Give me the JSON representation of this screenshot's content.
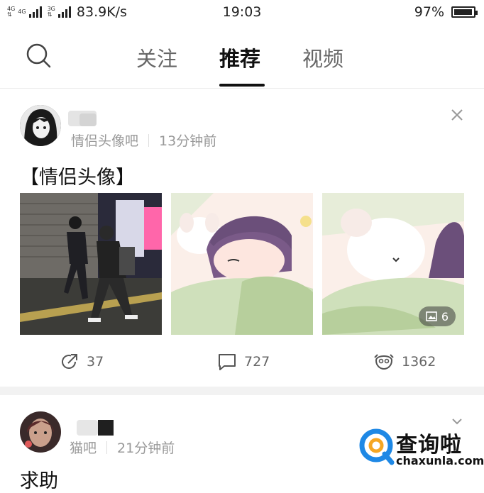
{
  "status_bar": {
    "network_labels": [
      "4G",
      "4G",
      "3G"
    ],
    "speed": "83.9K/s",
    "time": "19:03",
    "battery": "97%",
    "battery_level": 0.97
  },
  "nav": {
    "tabs": [
      {
        "label": "关注",
        "active": false
      },
      {
        "label": "推荐",
        "active": true
      },
      {
        "label": "视频",
        "active": false
      }
    ]
  },
  "posts": [
    {
      "source": "情侣头像吧",
      "time_ago": "13分钟前",
      "title": "【情侣头像】",
      "image_count": "6",
      "share_count": "37",
      "comment_count": "727",
      "like_count": "1362"
    },
    {
      "source": "猫吧",
      "time_ago": "21分钟前",
      "title": "求助"
    }
  ],
  "watermark": {
    "brand": "查询啦",
    "url": "chaxunla.com",
    "brand_color": "#1e88e5",
    "accent_color": "#f5a623"
  }
}
